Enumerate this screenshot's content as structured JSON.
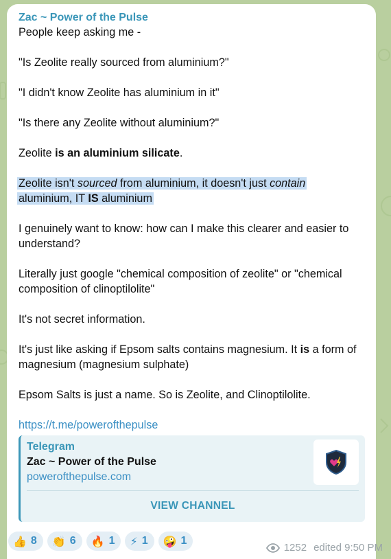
{
  "message": {
    "sender": "Zac ~ Power of the Pulse",
    "lines": {
      "l1": "People keep asking me -",
      "l2": "\"Is Zeolite really sourced from aluminium?\"",
      "l3": "\"I didn't know Zeolite has aluminium in it\"",
      "l4": "\"Is there any Zeolite without aluminium?\"",
      "l5_a": "Zeolite ",
      "l5_b": "is an aluminium silicate",
      "l5_c": ".",
      "l6_a": "Zeolite isn't ",
      "l6_b": "sourced",
      "l6_c": " from aluminium, it doesn't just ",
      "l6_d": "contain",
      "l6_e": "aluminium, IT ",
      "l6_f": "IS",
      "l6_g": " aluminium",
      "l7": "I genuinely want to know: how can I make this clearer and easier to understand?",
      "l8": "Literally just google \"chemical composition of zeolite\" or \"chemical composition of clinoptilolite\"",
      "l9": "It's not secret information.",
      "l10_a": "It's just like asking if Epsom salts contains magnesium. It ",
      "l10_b": "is",
      "l10_c": " a form of magnesium (magnesium sulphate)",
      "l11": "Epsom Salts is just a name. So is Zeolite, and Clinoptilolite.",
      "link": "https://t.me/powerofthepulse"
    }
  },
  "preview": {
    "site": "Telegram",
    "title": "Zac ~ Power of the Pulse",
    "url": "powerofthepulse.com",
    "button": "VIEW CHANNEL"
  },
  "reactions": [
    {
      "emoji": "👍",
      "count": "8"
    },
    {
      "emoji": "👏",
      "count": "6"
    },
    {
      "emoji": "🔥",
      "count": "1"
    },
    {
      "emoji": "⚡",
      "count": "1"
    },
    {
      "emoji": "🤪",
      "count": "1"
    }
  ],
  "meta": {
    "views": "1252",
    "edited": "edited 9:50 PM"
  },
  "colors": {
    "accent": "#3a96b8",
    "link": "#3a8fc4",
    "highlight": "#c5dcf3",
    "background": "#b9cf9f"
  }
}
